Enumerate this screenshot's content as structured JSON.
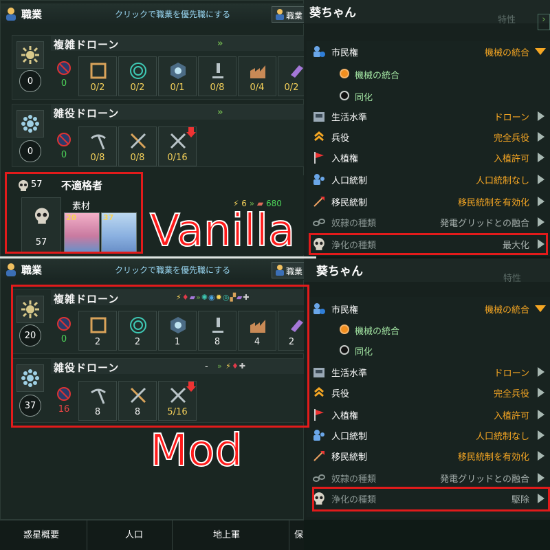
{
  "labels": {
    "vanilla": "Vanilla",
    "mod": "Mod"
  },
  "jobs_panel": {
    "title": "職業",
    "prioritize_hint": "クリックで職業を優先職にする",
    "header_button": "職業"
  },
  "vanilla": {
    "complex": {
      "title": "複雑ドローン",
      "pops": "0",
      "unemployed": "0",
      "slots": [
        {
          "icon": "alloy-icon",
          "value": "0/2"
        },
        {
          "icon": "unity-wave-icon",
          "value": "0/2"
        },
        {
          "icon": "eye-icon",
          "value": "0/1"
        },
        {
          "icon": "microscope-icon",
          "value": "0/8"
        },
        {
          "icon": "factory-icon",
          "value": "0/4"
        },
        {
          "icon": "consumer-goods-icon",
          "value": "0/2"
        }
      ]
    },
    "menial": {
      "title": "雑役ドローン",
      "pops": "0",
      "unemployed": "0",
      "slots": [
        {
          "icon": "pickaxe-icon",
          "value": "0/8"
        },
        {
          "icon": "tools-icon",
          "value": "0/8"
        },
        {
          "icon": "technician-icon",
          "value": "0/16"
        }
      ]
    },
    "unfit": {
      "count": "57",
      "title": "不適格者",
      "box_count": "57",
      "category": "素材",
      "energy": "6",
      "minerals": "680",
      "portraits": [
        {
          "n": "20"
        },
        {
          "n": "37"
        }
      ]
    }
  },
  "mod": {
    "complex": {
      "title": "複雑ドローン",
      "pops": "20",
      "unemployed": "0",
      "slots": [
        {
          "icon": "alloy-icon",
          "value": "2"
        },
        {
          "icon": "unity-wave-icon",
          "value": "2"
        },
        {
          "icon": "eye-icon",
          "value": "1"
        },
        {
          "icon": "microscope-icon",
          "value": "8"
        },
        {
          "icon": "factory-icon",
          "value": "4"
        },
        {
          "icon": "consumer-goods-icon",
          "value": "2"
        }
      ]
    },
    "menial": {
      "title": "雑役ドローン",
      "pops": "37",
      "unemployed": "16",
      "dash": "-",
      "slots": [
        {
          "icon": "pickaxe-icon",
          "value": "8"
        },
        {
          "icon": "tools-icon",
          "value": "8"
        },
        {
          "icon": "technician-icon",
          "value": "5/16"
        }
      ]
    }
  },
  "species_panel": {
    "name": "葵ちゃん",
    "tab_traits": "特性",
    "citizenship_label": "市民権",
    "citizenship_value": "機械の統合",
    "radio_1": "機械の統合",
    "radio_2": "同化",
    "living_standard_label": "生活水準",
    "living_standard_value": "ドローン",
    "military_label": "兵役",
    "military_value": "完全兵役",
    "colonization_label": "入植権",
    "colonization_value": "入植許可",
    "population_label": "人口統制",
    "population_value": "人口統制なし",
    "migration_label": "移民統制",
    "migration_value": "移民統制を有効化",
    "slavery_label": "奴隷の種類",
    "slavery_value": "発電グリッドとの融合"
  },
  "vanilla_purge": {
    "label": "浄化の種類",
    "value": "最大化"
  },
  "mod_purge": {
    "label": "浄化の種類",
    "value": "駆除"
  },
  "bottom_tabs": [
    "惑星概要",
    "人口",
    "地上軍",
    "保"
  ]
}
